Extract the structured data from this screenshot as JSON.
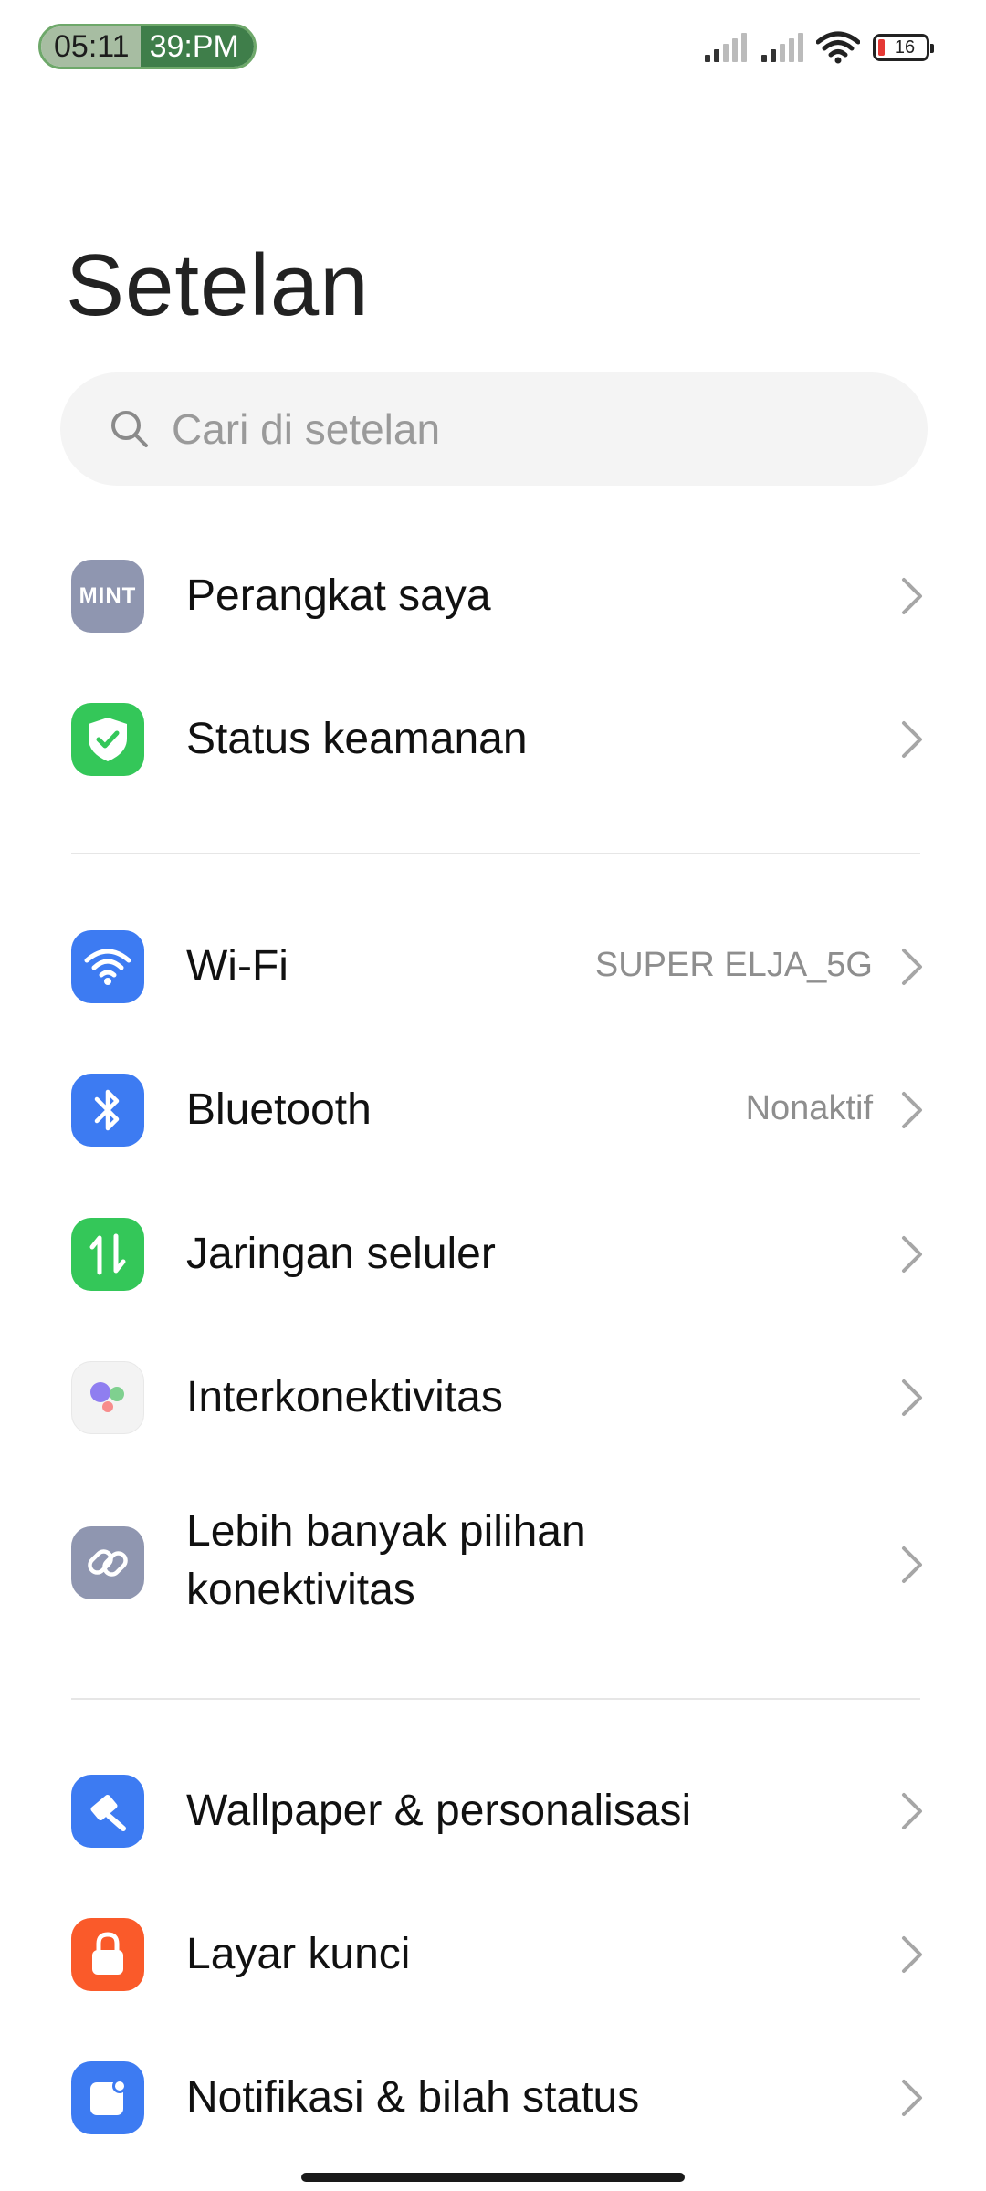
{
  "status_bar": {
    "time_part1": "05:11",
    "time_part2": "39:PM",
    "battery_level": "16"
  },
  "page": {
    "title": "Setelan"
  },
  "search": {
    "placeholder": "Cari di setelan"
  },
  "items": [
    {
      "label": "Perangkat saya",
      "value": "",
      "icon": "mint-icon",
      "color": "#8f96b0"
    },
    {
      "label": "Status keamanan",
      "value": "",
      "icon": "shield-check-icon",
      "color": "#34c759"
    },
    {
      "label": "Wi-Fi",
      "value": "SUPER ELJA_5G",
      "icon": "wifi-icon",
      "color": "#3d7bf2"
    },
    {
      "label": "Bluetooth",
      "value": "Nonaktif",
      "icon": "bluetooth-icon",
      "color": "#3d7bf2"
    },
    {
      "label": "Jaringan seluler",
      "value": "",
      "icon": "mobile-data-icon",
      "color": "#34c759"
    },
    {
      "label": "Interkonektivitas",
      "value": "",
      "icon": "interconnect-icon",
      "color": "#f1f1f1"
    },
    {
      "label_line1": "Lebih banyak pilihan",
      "label_line2": "konektivitas",
      "value": "",
      "icon": "link-icon",
      "color": "#8f96b0"
    },
    {
      "label": "Wallpaper & personalisasi",
      "value": "",
      "icon": "brush-icon",
      "color": "#3d7bf2"
    },
    {
      "label": "Layar kunci",
      "value": "",
      "icon": "lock-icon",
      "color": "#fa5a2a"
    },
    {
      "label": "Notifikasi & bilah status",
      "value": "",
      "icon": "notification-icon",
      "color": "#3d7bf2"
    }
  ],
  "mint_text": "MINT"
}
